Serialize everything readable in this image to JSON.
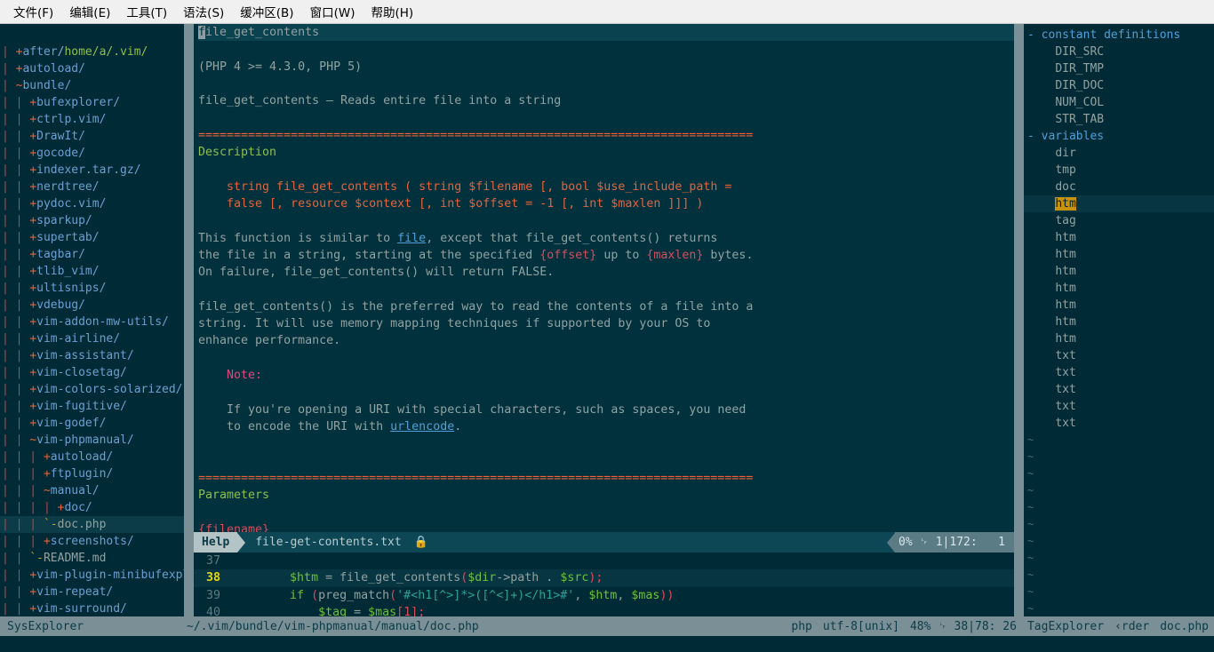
{
  "menu": {
    "items": [
      {
        "label": "文件(F)",
        "name": "menu-file"
      },
      {
        "label": "编辑(E)",
        "name": "menu-edit"
      },
      {
        "label": "工具(T)",
        "name": "menu-tools"
      },
      {
        "label": "语法(S)",
        "name": "menu-syntax"
      },
      {
        "label": "缓冲区(B)",
        "name": "menu-buffers"
      },
      {
        "label": "窗口(W)",
        "name": "menu-window"
      },
      {
        "label": "帮助(H)",
        "name": "menu-help"
      }
    ]
  },
  "explorer": {
    "root": "/home/a/.vim/",
    "rows": [
      {
        "guide": "|",
        "marker": "+",
        "label": "after/",
        "kind": "dir",
        "depth": 1
      },
      {
        "guide": "|",
        "marker": "+",
        "label": "autoload/",
        "kind": "dir",
        "depth": 1
      },
      {
        "guide": "|",
        "marker": "~",
        "label": "bundle/",
        "kind": "dir",
        "depth": 1
      },
      {
        "guide": "| |",
        "marker": "+",
        "label": "bufexplorer/",
        "kind": "dir",
        "depth": 2
      },
      {
        "guide": "| |",
        "marker": "+",
        "label": "ctrlp.vim/",
        "kind": "dir",
        "depth": 2
      },
      {
        "guide": "| |",
        "marker": "+",
        "label": "DrawIt/",
        "kind": "dir",
        "depth": 2
      },
      {
        "guide": "| |",
        "marker": "+",
        "label": "gocode/",
        "kind": "dir",
        "depth": 2
      },
      {
        "guide": "| |",
        "marker": "+",
        "label": "indexer.tar.gz/",
        "kind": "dir",
        "depth": 2
      },
      {
        "guide": "| |",
        "marker": "+",
        "label": "nerdtree/",
        "kind": "dir",
        "depth": 2
      },
      {
        "guide": "| |",
        "marker": "+",
        "label": "pydoc.vim/",
        "kind": "dir",
        "depth": 2
      },
      {
        "guide": "| |",
        "marker": "+",
        "label": "sparkup/",
        "kind": "dir",
        "depth": 2
      },
      {
        "guide": "| |",
        "marker": "+",
        "label": "supertab/",
        "kind": "dir",
        "depth": 2
      },
      {
        "guide": "| |",
        "marker": "+",
        "label": "tagbar/",
        "kind": "dir",
        "depth": 2
      },
      {
        "guide": "| |",
        "marker": "+",
        "label": "tlib_vim/",
        "kind": "dir",
        "depth": 2
      },
      {
        "guide": "| |",
        "marker": "+",
        "label": "ultisnips/",
        "kind": "dir",
        "depth": 2
      },
      {
        "guide": "| |",
        "marker": "+",
        "label": "vdebug/",
        "kind": "dir",
        "depth": 2
      },
      {
        "guide": "| |",
        "marker": "+",
        "label": "vim-addon-mw-utils/",
        "kind": "dir",
        "depth": 2
      },
      {
        "guide": "| |",
        "marker": "+",
        "label": "vim-airline/",
        "kind": "dir",
        "depth": 2
      },
      {
        "guide": "| |",
        "marker": "+",
        "label": "vim-assistant/",
        "kind": "dir",
        "depth": 2
      },
      {
        "guide": "| |",
        "marker": "+",
        "label": "vim-closetag/",
        "kind": "dir",
        "depth": 2
      },
      {
        "guide": "| |",
        "marker": "+",
        "label": "vim-colors-solarized/",
        "kind": "dir",
        "depth": 2
      },
      {
        "guide": "| |",
        "marker": "+",
        "label": "vim-fugitive/",
        "kind": "dir",
        "depth": 2
      },
      {
        "guide": "| |",
        "marker": "+",
        "label": "vim-godef/",
        "kind": "dir",
        "depth": 2
      },
      {
        "guide": "| |",
        "marker": "~",
        "label": "vim-phpmanual/",
        "kind": "dir",
        "depth": 2
      },
      {
        "guide": "| | |",
        "marker": "+",
        "label": "autoload/",
        "kind": "dir",
        "depth": 3
      },
      {
        "guide": "| | |",
        "marker": "+",
        "label": "ftplugin/",
        "kind": "dir",
        "depth": 3
      },
      {
        "guide": "| | |",
        "marker": "~",
        "label": "manual/",
        "kind": "dir",
        "depth": 3
      },
      {
        "guide": "| | | |",
        "marker": "+",
        "label": "doc/",
        "kind": "dir",
        "depth": 4
      },
      {
        "guide": "| | |",
        "marker": "`-",
        "label": "doc.php",
        "kind": "file",
        "depth": 4,
        "selected": true
      },
      {
        "guide": "| | |",
        "marker": "+",
        "label": "screenshots/",
        "kind": "dir",
        "depth": 3
      },
      {
        "guide": "| |",
        "marker": "`-",
        "label": "README.md",
        "kind": "file",
        "depth": 3
      },
      {
        "guide": "| |",
        "marker": "+",
        "label": "vim-plugin-minibufexpl/",
        "kind": "dir",
        "depth": 2
      },
      {
        "guide": "| |",
        "marker": "+",
        "label": "vim-repeat/",
        "kind": "dir",
        "depth": 2
      },
      {
        "guide": "| |",
        "marker": "+",
        "label": "vim-surround/",
        "kind": "dir",
        "depth": 2
      }
    ]
  },
  "help": {
    "title": "file_get_contents",
    "cursor_char": "f",
    "title_rest": "ile_get_contents",
    "lines": [
      "",
      "(PHP 4 >= 4.3.0, PHP 5)",
      "",
      "file_get_contents — Reads entire file into a string",
      "",
      "SEPARATOR",
      "Description",
      "",
      "    string file_get_contents ( string $filename [, bool $use_include_path =",
      "    false [, resource $context [, int $offset = -1 [, int $maxlen ]]] )",
      "",
      "This function is similar to file, except that file_get_contents() returns",
      "the file in a string, starting at the specified {offset} up to {maxlen} bytes.",
      "On failure, file_get_contents() will return FALSE.",
      "",
      "file_get_contents() is the preferred way to read the contents of a file into a",
      "string. It will use memory mapping techniques if supported by your OS to",
      "enhance performance.",
      "",
      "    Note:",
      "",
      "    If you're opening a URI with special characters, such as spaces, you need",
      "    to encode the URI with urlencode.",
      "",
      "SEPARATOR",
      "Parameters",
      "",
      "{filename}"
    ],
    "separator": "==============================================================================",
    "text": {
      "php_versions": "(PHP 4 >= 4.3.0, PHP 5)",
      "summary": "file_get_contents — Reads entire file into a string",
      "section_description": "Description",
      "signature_line1_pre": "    string file_get_contents ( string $filename [, bool $use_include_path =",
      "signature_line2_pre": "    false [, resource $context [, int $offset = -1 [, int $maxlen ]]] )",
      "para1_a": "This function is similar to ",
      "para1_link": "file",
      "para1_b": ", except that file_get_contents() returns",
      "para2_a": "the file in a string, starting at the specified ",
      "para2_off": "{offset}",
      "para2_b": " up to ",
      "para2_max": "{maxlen}",
      "para2_c": " bytes.",
      "para3": "On failure, file_get_contents() will return FALSE.",
      "para4": "file_get_contents() is the preferred way to read the contents of a file into a",
      "para5": "string. It will use memory mapping techniques if supported by your OS to",
      "para6": "enhance performance.",
      "note_label": "    Note:",
      "note_line1": "    If you're opening a URI with special characters, such as spaces, you need",
      "note_line2_a": "    to encode the URI with ",
      "note_link": "urlencode",
      "note_line2_b": ".",
      "section_parameters": "Parameters",
      "param_filename": "{filename}"
    }
  },
  "statusline": {
    "mode": "Help",
    "filename": "file-get-contents.txt",
    "lock_icon": "lock-icon",
    "percent": "0%",
    "line_glyph": "␊",
    "position": "1|172:   1"
  },
  "code": {
    "lines": [
      {
        "number": "37",
        "current": false,
        "tokens": [
          {
            "t": "",
            "c": "c-plain"
          }
        ]
      },
      {
        "number": "38",
        "current": true,
        "tokens": [
          {
            "t": "        ",
            "c": "c-plain"
          },
          {
            "t": "$htm",
            "c": "c-var"
          },
          {
            "t": " = ",
            "c": "c-plain"
          },
          {
            "t": "file_get_contents",
            "c": "c-fn"
          },
          {
            "t": "(",
            "c": "c-punc"
          },
          {
            "t": "$dir",
            "c": "c-var"
          },
          {
            "t": "->path",
            "c": "c-plain"
          },
          {
            "t": " . ",
            "c": "c-plain"
          },
          {
            "t": "$src",
            "c": "c-var"
          },
          {
            "t": ");",
            "c": "c-punc"
          }
        ]
      },
      {
        "number": "39",
        "current": false,
        "tokens": [
          {
            "t": "        ",
            "c": "c-plain"
          },
          {
            "t": "if ",
            "c": "c-kw"
          },
          {
            "t": "(",
            "c": "c-punc"
          },
          {
            "t": "preg_match",
            "c": "c-fn"
          },
          {
            "t": "(",
            "c": "c-punc"
          },
          {
            "t": "'#<h1[^>]*>([^<]+)</h1>#'",
            "c": "c-str"
          },
          {
            "t": ", ",
            "c": "c-plain"
          },
          {
            "t": "$htm",
            "c": "c-var"
          },
          {
            "t": ", ",
            "c": "c-plain"
          },
          {
            "t": "$mas",
            "c": "c-var"
          },
          {
            "t": "))",
            "c": "c-punc"
          }
        ]
      },
      {
        "number": "40",
        "current": false,
        "tokens": [
          {
            "t": "            ",
            "c": "c-plain"
          },
          {
            "t": "$tag",
            "c": "c-var"
          },
          {
            "t": " = ",
            "c": "c-plain"
          },
          {
            "t": "$mas",
            "c": "c-var"
          },
          {
            "t": "[",
            "c": "c-punc"
          },
          {
            "t": "1",
            "c": "c-num"
          },
          {
            "t": "];",
            "c": "c-punc"
          }
        ]
      }
    ]
  },
  "tagbar": {
    "rows": [
      {
        "fold": "-",
        "label": "constant definitions",
        "type": "group"
      },
      {
        "fold": "",
        "label": "DIR_SRC",
        "type": "tag"
      },
      {
        "fold": "",
        "label": "DIR_TMP",
        "type": "tag"
      },
      {
        "fold": "",
        "label": "DIR_DOC",
        "type": "tag"
      },
      {
        "fold": "",
        "label": "NUM_COL",
        "type": "tag"
      },
      {
        "fold": "",
        "label": "STR_TAB",
        "type": "tag"
      },
      {
        "fold": "-",
        "label": "variables",
        "type": "group"
      },
      {
        "fold": "",
        "label": "dir",
        "type": "tag"
      },
      {
        "fold": "",
        "label": "tmp",
        "type": "tag"
      },
      {
        "fold": "",
        "label": "doc",
        "type": "tag"
      },
      {
        "fold": "",
        "label": "htm",
        "type": "tag",
        "highlighted": true
      },
      {
        "fold": "",
        "label": "tag",
        "type": "tag"
      },
      {
        "fold": "",
        "label": "htm",
        "type": "tag"
      },
      {
        "fold": "",
        "label": "htm",
        "type": "tag"
      },
      {
        "fold": "",
        "label": "htm",
        "type": "tag"
      },
      {
        "fold": "",
        "label": "htm",
        "type": "tag"
      },
      {
        "fold": "",
        "label": "htm",
        "type": "tag"
      },
      {
        "fold": "",
        "label": "htm",
        "type": "tag"
      },
      {
        "fold": "",
        "label": "htm",
        "type": "tag"
      },
      {
        "fold": "",
        "label": "txt",
        "type": "tag"
      },
      {
        "fold": "",
        "label": "txt",
        "type": "tag"
      },
      {
        "fold": "",
        "label": "txt",
        "type": "tag"
      },
      {
        "fold": "",
        "label": "txt",
        "type": "tag"
      },
      {
        "fold": "",
        "label": "txt",
        "type": "tag"
      },
      {
        "fold": "",
        "label": "~",
        "type": "empty"
      },
      {
        "fold": "",
        "label": "~",
        "type": "empty"
      },
      {
        "fold": "",
        "label": "~",
        "type": "empty"
      },
      {
        "fold": "",
        "label": "~",
        "type": "empty"
      },
      {
        "fold": "",
        "label": "~",
        "type": "empty"
      },
      {
        "fold": "",
        "label": "~",
        "type": "empty"
      },
      {
        "fold": "",
        "label": "~",
        "type": "empty"
      },
      {
        "fold": "",
        "label": "~",
        "type": "empty"
      },
      {
        "fold": "",
        "label": "~",
        "type": "empty"
      },
      {
        "fold": "",
        "label": "~",
        "type": "empty"
      },
      {
        "fold": "",
        "label": "~",
        "type": "empty"
      }
    ]
  },
  "bottombar": {
    "left_label": "SysExplorer",
    "path": "~/.vim/bundle/vim-phpmanual/manual/doc.php",
    "filetype": "php",
    "encoding": "utf-8[unix]",
    "percent": "48%",
    "line_glyph": "␊",
    "position": "38|78: 26",
    "window_name": "TagExplorer",
    "truncated": "‹rder",
    "buffer": "doc.php"
  },
  "colors": {
    "background": "#002b36",
    "help_background": "#00313d",
    "accent_orange": "#e8623a",
    "accent_green": "#8fbf4a",
    "accent_blue": "#4f9fd8",
    "accent_red": "#dc4a5a",
    "divider": "#7a8f96",
    "tag_highlight": "#c8920c",
    "cursor_line": "#073642"
  }
}
